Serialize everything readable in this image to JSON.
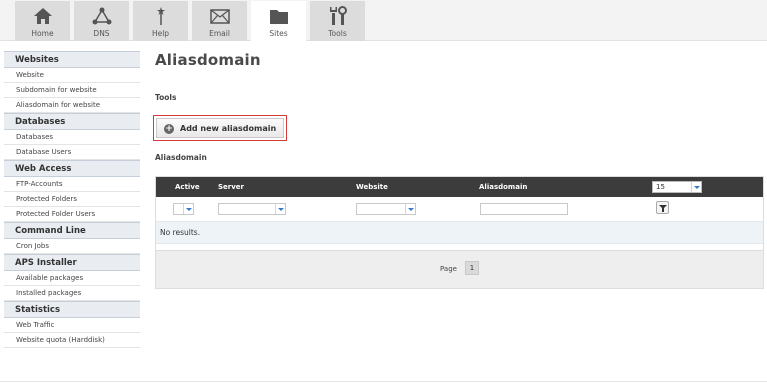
{
  "tabs": [
    {
      "label": "Home",
      "icon": "home-icon"
    },
    {
      "label": "DNS",
      "icon": "dns-network-icon"
    },
    {
      "label": "Help",
      "icon": "help-wand-icon"
    },
    {
      "label": "Email",
      "icon": "envelope-icon"
    },
    {
      "label": "Sites",
      "icon": "folder-icon",
      "active": true
    },
    {
      "label": "Tools",
      "icon": "tools-icon"
    }
  ],
  "sidebar": {
    "groups": [
      {
        "title": "Websites",
        "items": [
          "Website",
          "Subdomain for website",
          "Aliasdomain for website"
        ]
      },
      {
        "title": "Databases",
        "items": [
          "Databases",
          "Database Users"
        ]
      },
      {
        "title": "Web Access",
        "items": [
          "FTP-Accounts",
          "Protected Folders",
          "Protected Folder Users"
        ]
      },
      {
        "title": "Command Line",
        "items": [
          "Cron Jobs"
        ]
      },
      {
        "title": "APS Installer",
        "items": [
          "Available packages",
          "Installed packages"
        ]
      },
      {
        "title": "Statistics",
        "items": [
          "Web Traffic",
          "Website quota (Harddisk)"
        ]
      }
    ]
  },
  "main": {
    "title": "Aliasdomain",
    "tools_label": "Tools",
    "add_button_label": "Add new aliasdomain",
    "list_label": "Aliasdomain",
    "columns": [
      "Active",
      "Server",
      "Website",
      "Aliasdomain"
    ],
    "page_size": "15",
    "no_results": "No results.",
    "page_label": "Page",
    "page_number": "1"
  },
  "colors": {
    "accent_blue": "#3a78c8",
    "highlight_red": "#d43a3a",
    "grid_header": "#3c3c3c"
  }
}
